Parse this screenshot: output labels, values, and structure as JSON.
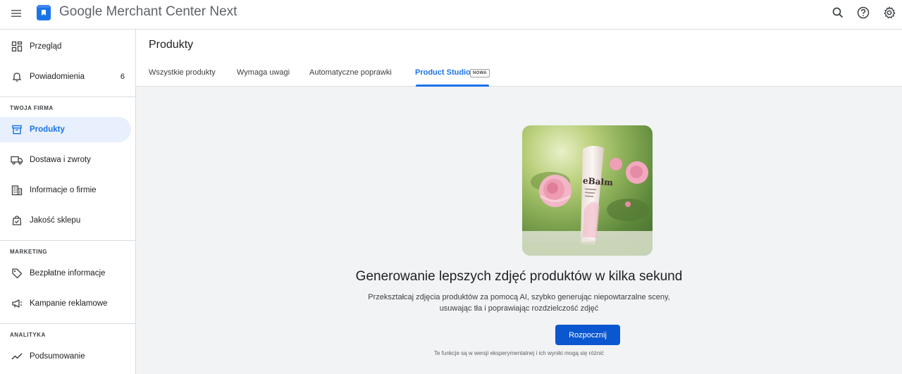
{
  "app": {
    "title_brand": "Google",
    "title_rest": " Merchant Center Next",
    "icons": [
      "menu-icon",
      "merchant-logo-icon",
      "search-icon",
      "help-icon",
      "settings-icon"
    ]
  },
  "sidebar": {
    "top_items": [
      {
        "label": "Przegląd",
        "icon": "overview-icon"
      },
      {
        "label": "Powiadomienia",
        "icon": "bell-icon",
        "badge": "6"
      }
    ],
    "sections": [
      {
        "label": "TWOJA FIRMA",
        "items": [
          {
            "label": "Produkty",
            "icon": "product-box-icon",
            "active": true
          },
          {
            "label": "Dostawa i zwroty",
            "icon": "truck-icon"
          },
          {
            "label": "Informacje o firmie",
            "icon": "building-icon"
          },
          {
            "label": "Jakość sklepu",
            "icon": "store-quality-icon"
          }
        ]
      },
      {
        "label": "MARKETING",
        "items": [
          {
            "label": "Bezpłatne informacje",
            "icon": "tag-icon"
          },
          {
            "label": "Kampanie reklamowe",
            "icon": "megaphone-icon"
          }
        ]
      },
      {
        "label": "ANALITYKA",
        "items": [
          {
            "label": "Podsumowanie",
            "icon": "trend-icon"
          }
        ]
      }
    ]
  },
  "main": {
    "page_title": "Produkty",
    "tabs": [
      {
        "label": "Wszystkie produkty"
      },
      {
        "label": "Wymaga uwagi"
      },
      {
        "label": "Automatyczne poprawki"
      },
      {
        "label": "Product Studio",
        "active": true,
        "badge": "NOWA"
      }
    ],
    "hero": {
      "product_text": "eBalm",
      "headline": "Generowanie lepszych zdjęć produktów w kilka sekund",
      "description_line1": "Przekształcaj zdjęcia produktów za pomocą AI, szybko generując niepowtarzalne sceny,",
      "description_line2": "usuwając tła i poprawiając rozdzielczość zdjęć",
      "cta_label": "Rozpocznij",
      "disclaimer": "Te funkcje są w wersji eksperymentalnej i ich wyniki mogą się różnić"
    }
  },
  "colors": {
    "accent": "#1a73e8",
    "cta": "#0b57d0",
    "active_bg": "#e8f0fe",
    "canvas": "#f1f3f4"
  }
}
